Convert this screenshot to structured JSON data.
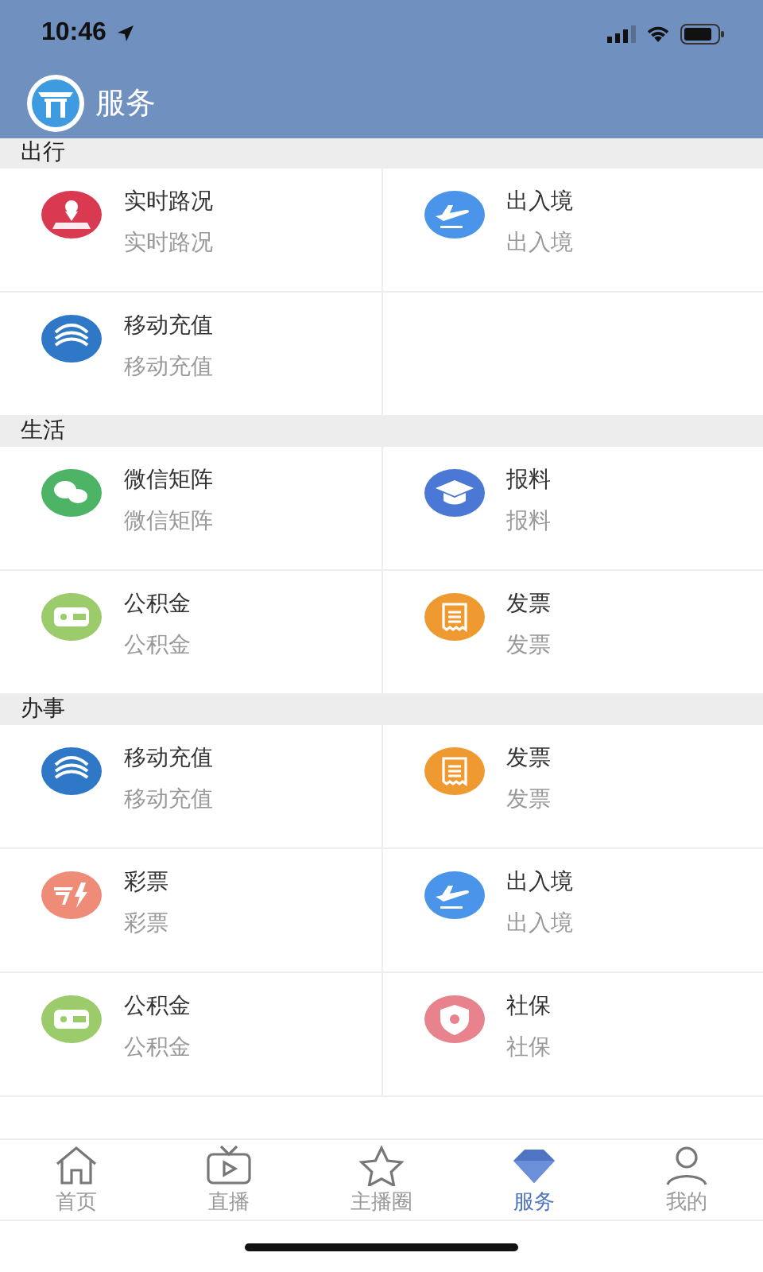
{
  "status_bar": {
    "time": "10:46"
  },
  "header": {
    "title": "服务"
  },
  "sections": [
    {
      "title": "出行",
      "items": [
        {
          "title": "实时路况",
          "subtitle": "实时路况",
          "kind": "location",
          "color": "#d93a52"
        },
        {
          "title": "出入境",
          "subtitle": "出入境",
          "kind": "plane",
          "color": "#4a94ea"
        },
        {
          "title": "移动充值",
          "subtitle": "移动充值",
          "kind": "mobile",
          "color": "#2f78c8"
        }
      ]
    },
    {
      "title": "生活",
      "items": [
        {
          "title": "微信矩阵",
          "subtitle": "微信矩阵",
          "kind": "chat",
          "color": "#4cb464"
        },
        {
          "title": "报料",
          "subtitle": "报料",
          "kind": "cap",
          "color": "#4a78d4"
        },
        {
          "title": "公积金",
          "subtitle": "公积金",
          "kind": "wallet",
          "color": "#9ccb6c"
        },
        {
          "title": "发票",
          "subtitle": "发票",
          "kind": "invoice",
          "color": "#ef9a30"
        }
      ]
    },
    {
      "title": "办事",
      "items": [
        {
          "title": "移动充值",
          "subtitle": "移动充值",
          "kind": "mobile",
          "color": "#2f78c8"
        },
        {
          "title": "发票",
          "subtitle": "发票",
          "kind": "invoice",
          "color": "#ef9a30"
        },
        {
          "title": "彩票",
          "subtitle": "彩票",
          "kind": "lottery",
          "color": "#ee8c78"
        },
        {
          "title": "出入境",
          "subtitle": "出入境",
          "kind": "plane",
          "color": "#4a94ea"
        },
        {
          "title": "公积金",
          "subtitle": "公积金",
          "kind": "wallet",
          "color": "#9ccb6c"
        },
        {
          "title": "社保",
          "subtitle": "社保",
          "kind": "shield",
          "color": "#e8828c"
        }
      ]
    }
  ],
  "tabs": [
    {
      "label": "首页",
      "kind": "home",
      "selected": false
    },
    {
      "label": "直播",
      "kind": "tv",
      "selected": false
    },
    {
      "label": "主播圈",
      "kind": "star",
      "selected": false
    },
    {
      "label": "服务",
      "kind": "gem",
      "selected": true
    },
    {
      "label": "我的",
      "kind": "person",
      "selected": false
    }
  ]
}
